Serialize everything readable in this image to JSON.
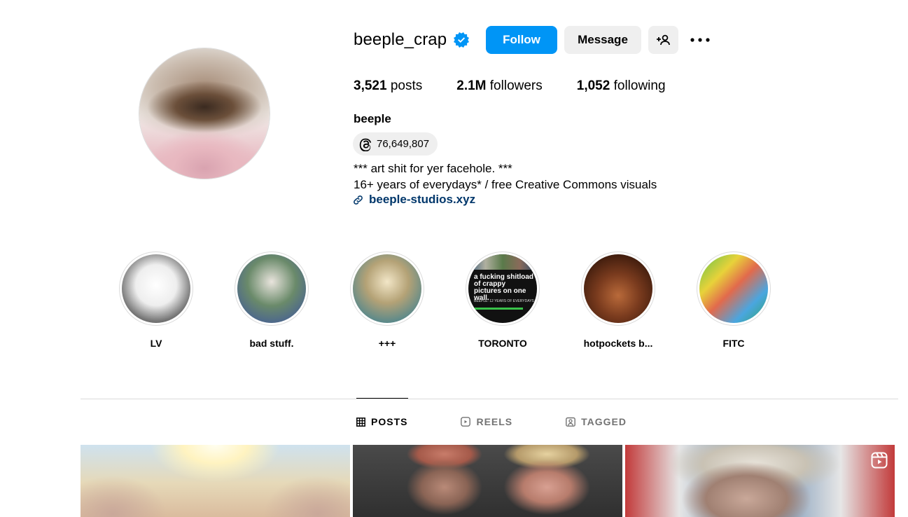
{
  "profile": {
    "username": "beeple_crap",
    "verified": true,
    "full_name": "beeple",
    "threads_count": "76,649,807",
    "bio_line1": "*** art shit for yer facehole. ***",
    "bio_line2": "16+ years of everydays* / free Creative Commons visuals",
    "link_text": "beeple-studios.xyz"
  },
  "actions": {
    "follow_label": "Follow",
    "message_label": "Message"
  },
  "stats": {
    "posts_count": "3,521",
    "posts_label": "posts",
    "followers_count": "2.1M",
    "followers_label": "followers",
    "following_count": "1,052",
    "following_label": "following"
  },
  "highlights": [
    {
      "label": "LV"
    },
    {
      "label": "bad stuff."
    },
    {
      "label": "+++"
    },
    {
      "label": "TORONTO",
      "cover_text": "a fucking shitload of crappy pictures on one wall.",
      "cover_subtext": "BEEPLE: 12 YEARS OF EVERYDAYS"
    },
    {
      "label": "hotpockets b..."
    },
    {
      "label": "FITC"
    }
  ],
  "tabs": [
    {
      "label": "POSTS",
      "icon": "grid-icon",
      "active": true
    },
    {
      "label": "REELS",
      "icon": "reels-icon",
      "active": false
    },
    {
      "label": "TAGGED",
      "icon": "tagged-icon",
      "active": false
    }
  ],
  "colors": {
    "primary_button": "#0095f6",
    "secondary_button": "#efefef",
    "link": "#00376b",
    "verified": "#0095f6",
    "divider": "#dbdbdb"
  }
}
